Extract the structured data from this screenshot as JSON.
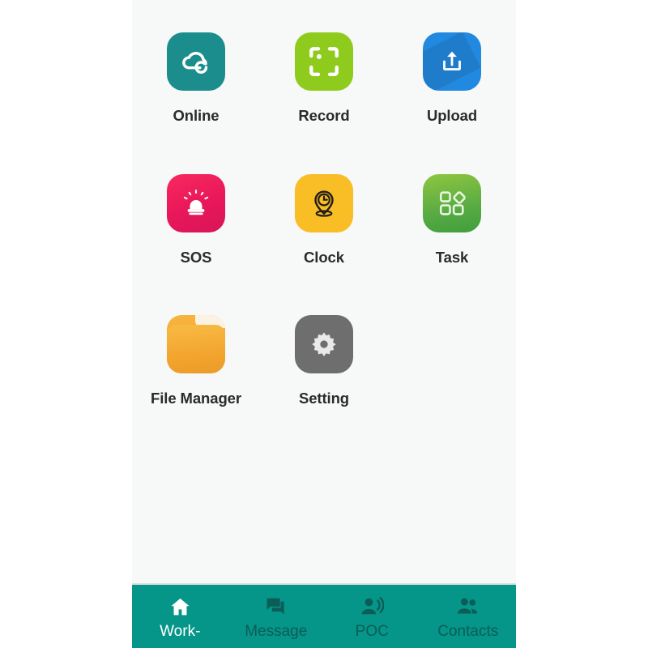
{
  "app": {
    "background_color": "#f7f8f8",
    "outside_color": "#ffffff"
  },
  "home": {
    "apps": [
      {
        "label": "Online",
        "icon": "cloud-sync-icon",
        "color": "#1c8d8d"
      },
      {
        "label": "Record",
        "icon": "scan-frame-icon",
        "color": "#8fcb1d"
      },
      {
        "label": "Upload",
        "icon": "upload-tray-icon",
        "color": "#2289e0"
      },
      {
        "label": "SOS",
        "icon": "alarm-siren-icon",
        "color": "#e8175a"
      },
      {
        "label": "Clock",
        "icon": "location-clock-icon",
        "color": "#f9bd26"
      },
      {
        "label": "Task",
        "icon": "shapes-grid-icon",
        "color": "#59ab44"
      },
      {
        "label": "File Manager",
        "icon": "folder-icon",
        "color": "#f2a52f"
      },
      {
        "label": "Setting",
        "icon": "gear-icon",
        "color": "#6e6e6e"
      }
    ]
  },
  "bottom_nav": {
    "background_color": "#059589",
    "active_color": "#ffffff",
    "inactive_color": "#0b5d57",
    "items": [
      {
        "label": "Work-",
        "icon": "home-icon",
        "active": true
      },
      {
        "label": "Message",
        "icon": "forum-chat-icon",
        "active": false
      },
      {
        "label": "POC",
        "icon": "record-voice-over-icon",
        "active": false
      },
      {
        "label": "Contacts",
        "icon": "people-group-icon",
        "active": false
      }
    ]
  }
}
